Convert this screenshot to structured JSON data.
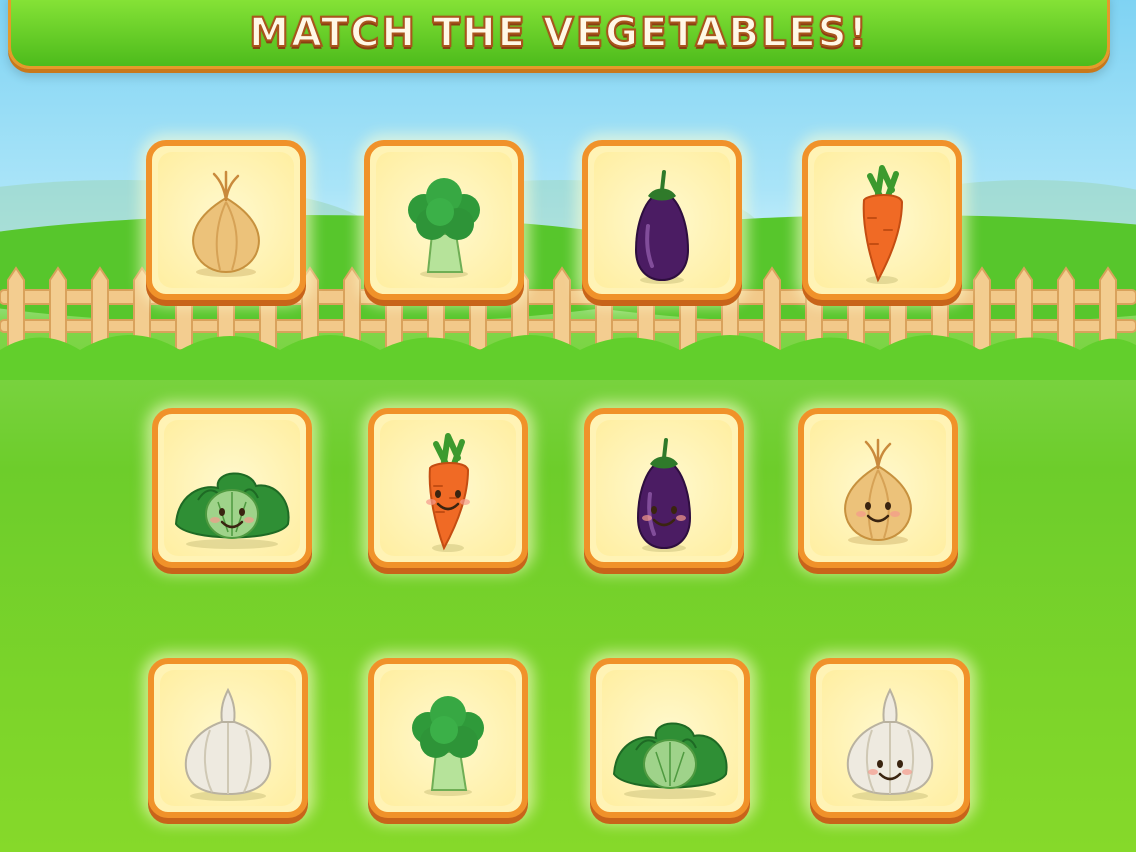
{
  "title": "MATCH THE VEGETABLES!",
  "colors": {
    "banner": "#5fcd25",
    "card_border": "#f0922a",
    "card_face": "#fff3b5",
    "grass": "#6dcd2b",
    "sky": "#8fd8f5"
  },
  "cards": [
    {
      "vegetable": "onion"
    },
    {
      "vegetable": "broccoli"
    },
    {
      "vegetable": "eggplant"
    },
    {
      "vegetable": "carrot"
    },
    {
      "vegetable": "cabbage",
      "face": true
    },
    {
      "vegetable": "carrot",
      "face": true
    },
    {
      "vegetable": "eggplant",
      "face": true
    },
    {
      "vegetable": "onion",
      "face": true
    },
    {
      "vegetable": "garlic"
    },
    {
      "vegetable": "broccoli"
    },
    {
      "vegetable": "cabbage"
    },
    {
      "vegetable": "garlic",
      "face": true
    }
  ]
}
